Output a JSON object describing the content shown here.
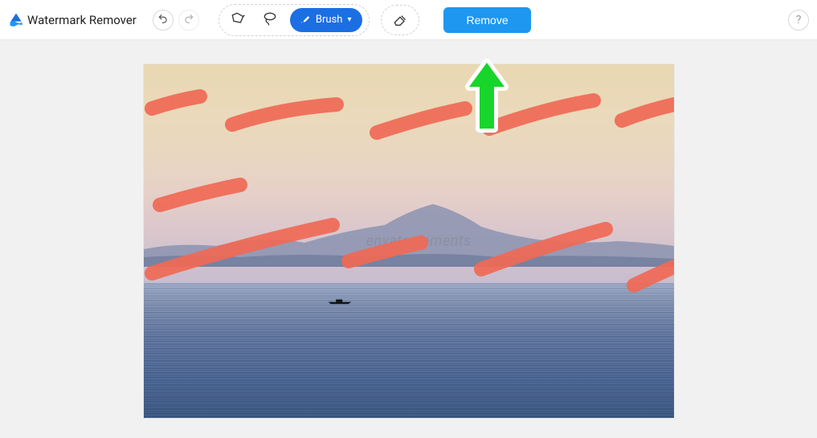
{
  "app": {
    "title": "Watermark Remover"
  },
  "toolbar": {
    "brush_label": "Brush",
    "remove_label": "Remove"
  },
  "canvas": {
    "watermark_text": "envatoelements"
  },
  "colors": {
    "primary_button": "#1b6fe3",
    "action_button": "#1d97f0",
    "brush_stroke": "#f06a56",
    "arrow": "#17d52a",
    "arrow_outline": "#ffffff"
  }
}
